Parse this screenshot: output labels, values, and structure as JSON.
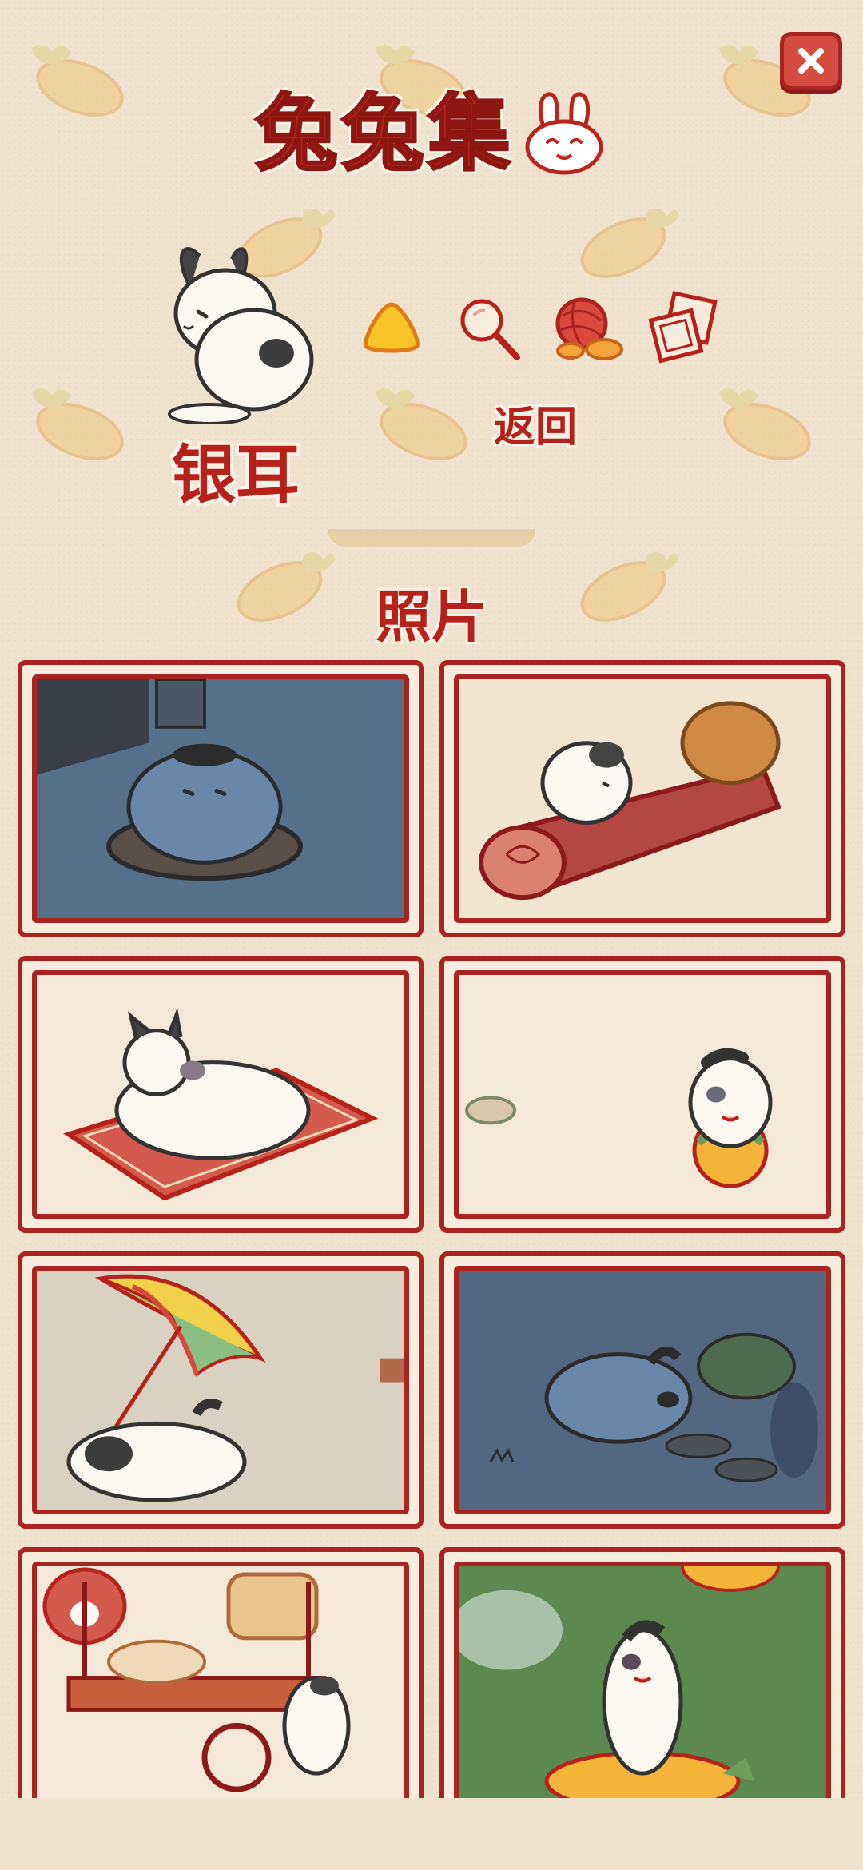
{
  "header": {
    "title": "兔兔集",
    "close_icon": "close-icon"
  },
  "profile": {
    "name": "银耳"
  },
  "actions": {
    "items": [
      {
        "icon": "rice-ball-icon"
      },
      {
        "icon": "magnifier-icon"
      },
      {
        "icon": "yarn-ball-icon"
      },
      {
        "icon": "photo-frames-icon"
      }
    ],
    "back_label": "返回"
  },
  "photos": {
    "section_title": "照片",
    "items": [
      {
        "scene": "rabbit-on-cushion-night"
      },
      {
        "scene": "rabbit-on-log"
      },
      {
        "scene": "rabbit-on-rug"
      },
      {
        "scene": "rabbit-with-ball"
      },
      {
        "scene": "rabbit-under-umbrella"
      },
      {
        "scene": "rabbits-in-garden-night"
      },
      {
        "scene": "rabbit-at-food-cart"
      },
      {
        "scene": "rabbit-on-grass"
      }
    ]
  },
  "colors": {
    "accent_red": "#b62119",
    "border_red": "#a92320",
    "background": "#efe2cf",
    "night_blue": "#53687f"
  }
}
